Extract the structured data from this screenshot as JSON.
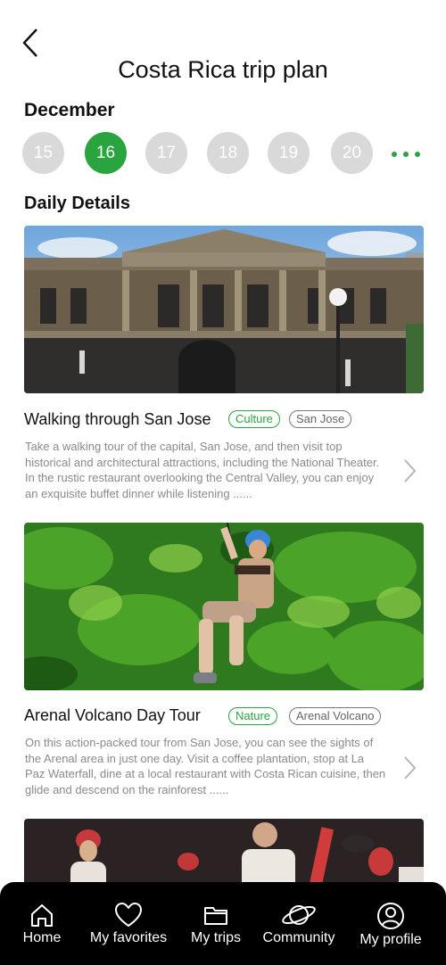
{
  "header": {
    "title": "Costa Rica trip plan"
  },
  "calendar": {
    "month": "December",
    "dates": [
      "15",
      "16",
      "17",
      "18",
      "19",
      "20"
    ],
    "selected": "16"
  },
  "details": {
    "heading": "Daily Details",
    "items": [
      {
        "title": "Walking through San Jose",
        "category": "Culture",
        "location": "San Jose",
        "description": "Take a walking tour of the capital, San Jose, and then visit top historical and architectural attractions, including the National Theater. In the rustic restaurant overlooking the Central Valley, you can enjoy an exquisite buffet dinner while listening ......"
      },
      {
        "title": "Arenal Volcano Day Tour",
        "category": "Nature",
        "location": "Arenal Volcano",
        "description": "On this action-packed tour from San Jose, you can see the sights of the Arenal area in just one day. Visit a coffee plantation, stop at La Paz Waterfall, dine at a local restaurant with Costa Rican cuisine, then glide and descend on the rainforest ......"
      }
    ]
  },
  "tabs": [
    "Home",
    "My favorites",
    "My trips",
    "Community",
    "My profile"
  ],
  "colors": {
    "accent": "#2aa43f",
    "inactive_date": "#d9d9d9",
    "tabbar": "#000000"
  },
  "icons": {
    "back": "back-arrow-icon",
    "more": "more-dots-icon",
    "chevron": "chevron-right-icon",
    "home": "home-icon",
    "favorites": "heart-icon",
    "trips": "folder-icon",
    "community": "planet-icon",
    "profile": "user-icon"
  }
}
